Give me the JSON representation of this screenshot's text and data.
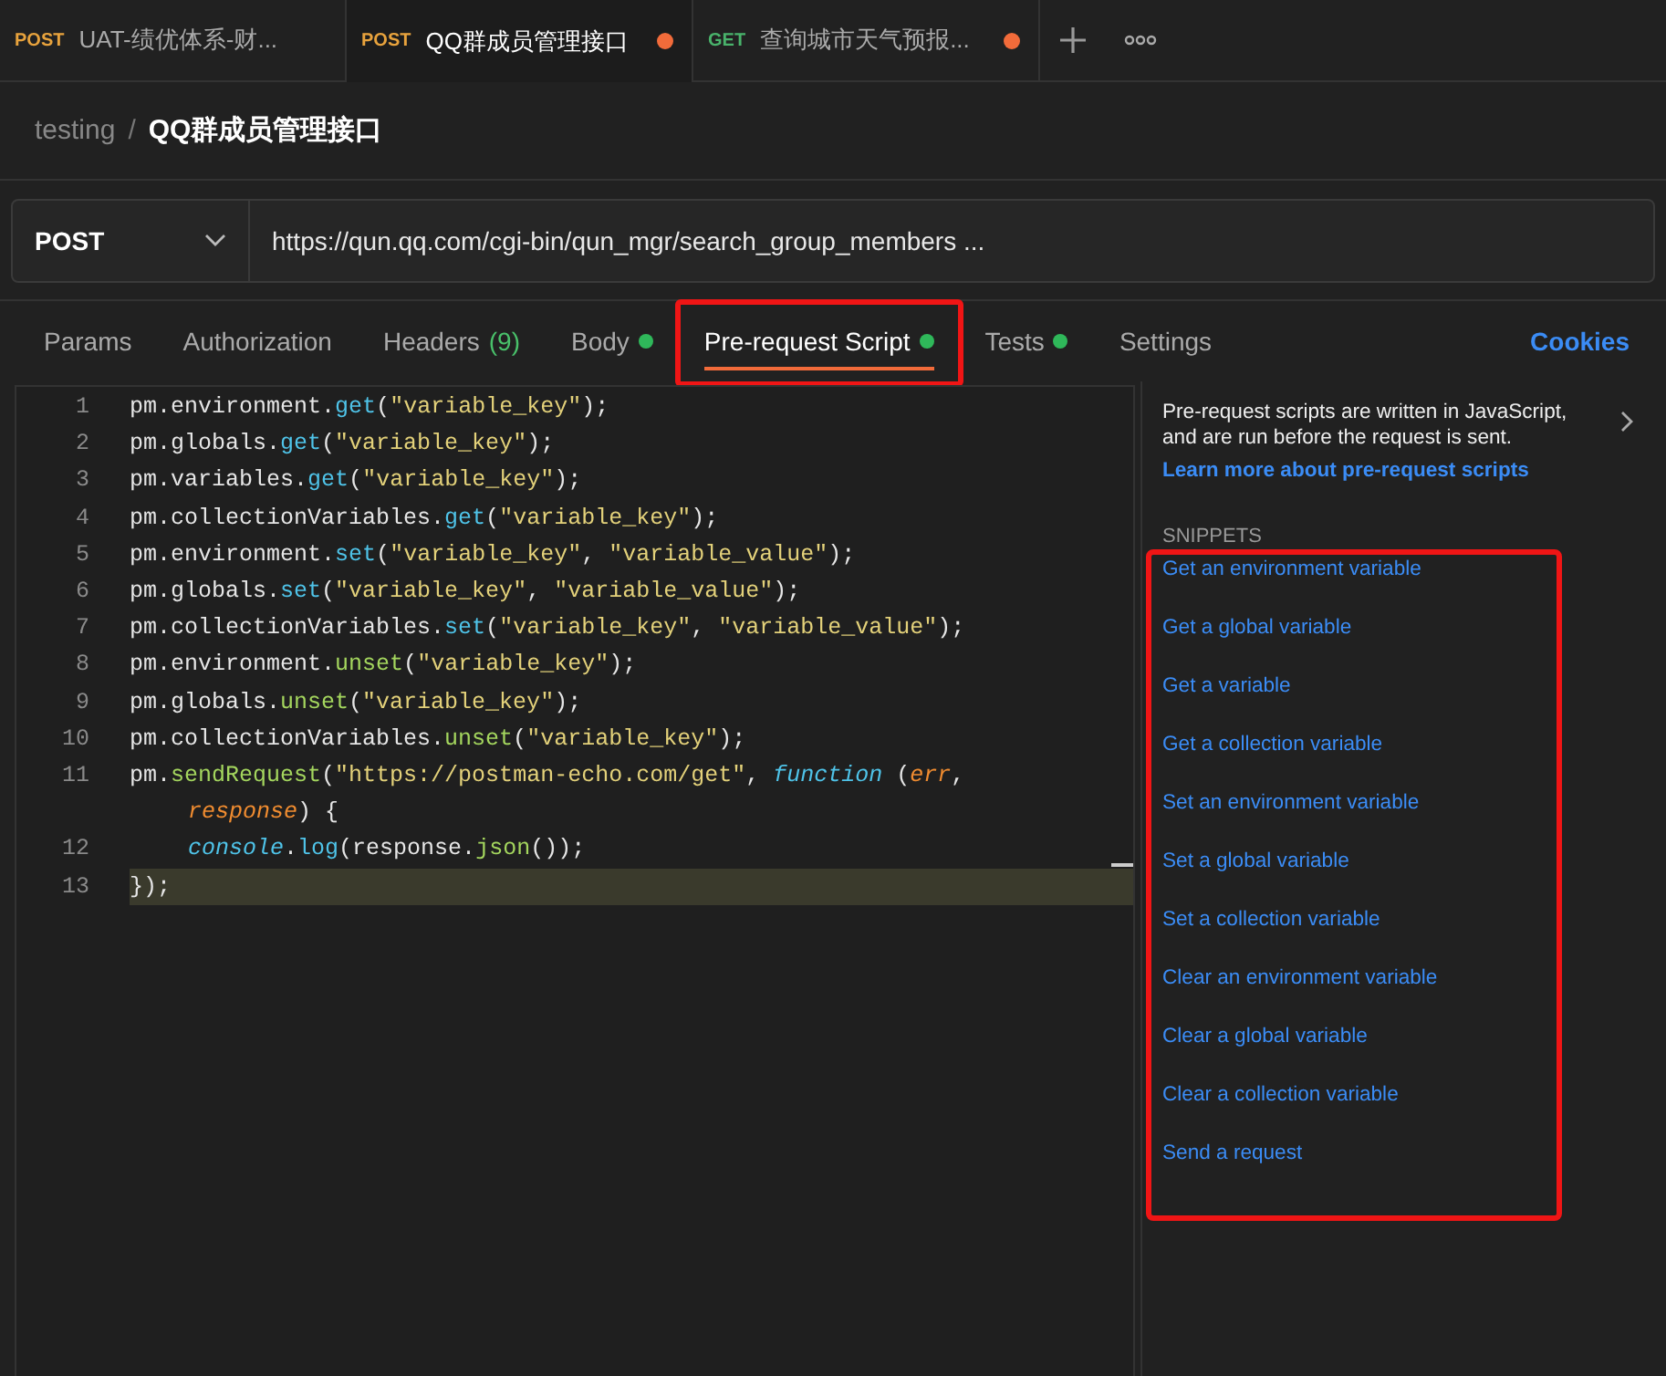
{
  "tabs": [
    {
      "method": "POST",
      "title": "UAT-绩优体系-财...",
      "selected": false,
      "unsaved": false
    },
    {
      "method": "POST",
      "title": "QQ群成员管理接口",
      "selected": true,
      "unsaved": true
    },
    {
      "method": "GET",
      "title": "查询城市天气预报...",
      "selected": false,
      "unsaved": true
    }
  ],
  "breadcrumb": {
    "collection": "testing",
    "separator": "/",
    "request": "QQ群成员管理接口"
  },
  "request": {
    "method": "POST",
    "url": "https://qun.qq.com/cgi-bin/qun_mgr/search_group_members ..."
  },
  "request_tabs": [
    {
      "label": "Params",
      "selected": false
    },
    {
      "label": "Authorization",
      "selected": false
    },
    {
      "label": "Headers",
      "count": "(9)",
      "selected": false
    },
    {
      "label": "Body",
      "dot": true,
      "selected": false
    },
    {
      "label": "Pre-request Script",
      "dot": true,
      "selected": true,
      "highlighted": true
    },
    {
      "label": "Tests",
      "dot": true,
      "selected": false
    },
    {
      "label": "Settings",
      "selected": false
    }
  ],
  "cookies_link": "Cookies",
  "editor": {
    "lines": [
      {
        "number": "1",
        "current": false,
        "tokens": [
          {
            "kind": "plain",
            "text": "pm.environment."
          },
          {
            "kind": "call",
            "text": "get"
          },
          {
            "kind": "plain",
            "text": "("
          },
          {
            "kind": "string",
            "text": "\"variable_key\""
          },
          {
            "kind": "plain",
            "text": ");"
          }
        ]
      },
      {
        "number": "2",
        "current": false,
        "tokens": [
          {
            "kind": "plain",
            "text": "pm.globals."
          },
          {
            "kind": "call",
            "text": "get"
          },
          {
            "kind": "plain",
            "text": "("
          },
          {
            "kind": "string",
            "text": "\"variable_key\""
          },
          {
            "kind": "plain",
            "text": ");"
          }
        ]
      },
      {
        "number": "3",
        "current": false,
        "tokens": [
          {
            "kind": "plain",
            "text": "pm.variables."
          },
          {
            "kind": "call",
            "text": "get"
          },
          {
            "kind": "plain",
            "text": "("
          },
          {
            "kind": "string",
            "text": "\"variable_key\""
          },
          {
            "kind": "plain",
            "text": ");"
          }
        ]
      },
      {
        "number": "4",
        "current": false,
        "tokens": [
          {
            "kind": "plain",
            "text": "pm.collectionVariables."
          },
          {
            "kind": "call",
            "text": "get"
          },
          {
            "kind": "plain",
            "text": "("
          },
          {
            "kind": "string",
            "text": "\"variable_key\""
          },
          {
            "kind": "plain",
            "text": ");"
          }
        ]
      },
      {
        "number": "5",
        "current": false,
        "tokens": [
          {
            "kind": "plain",
            "text": "pm.environment."
          },
          {
            "kind": "call",
            "text": "set"
          },
          {
            "kind": "plain",
            "text": "("
          },
          {
            "kind": "string",
            "text": "\"variable_key\""
          },
          {
            "kind": "plain",
            "text": ", "
          },
          {
            "kind": "string",
            "text": "\"variable_value\""
          },
          {
            "kind": "plain",
            "text": ");"
          }
        ]
      },
      {
        "number": "6",
        "current": false,
        "tokens": [
          {
            "kind": "plain",
            "text": "pm.globals."
          },
          {
            "kind": "call",
            "text": "set"
          },
          {
            "kind": "plain",
            "text": "("
          },
          {
            "kind": "string",
            "text": "\"variable_key\""
          },
          {
            "kind": "plain",
            "text": ", "
          },
          {
            "kind": "string",
            "text": "\"variable_value\""
          },
          {
            "kind": "plain",
            "text": ");"
          }
        ]
      },
      {
        "number": "7",
        "current": false,
        "tokens": [
          {
            "kind": "plain",
            "text": "pm.collectionVariables."
          },
          {
            "kind": "call",
            "text": "set"
          },
          {
            "kind": "plain",
            "text": "("
          },
          {
            "kind": "string",
            "text": "\"variable_key\""
          },
          {
            "kind": "plain",
            "text": ", "
          },
          {
            "kind": "string",
            "text": "\"variable_value\""
          },
          {
            "kind": "plain",
            "text": ");"
          }
        ]
      },
      {
        "number": "8",
        "current": false,
        "tokens": [
          {
            "kind": "plain",
            "text": "pm.environment."
          },
          {
            "kind": "fn",
            "text": "unset"
          },
          {
            "kind": "plain",
            "text": "("
          },
          {
            "kind": "string",
            "text": "\"variable_key\""
          },
          {
            "kind": "plain",
            "text": ");"
          }
        ]
      },
      {
        "number": "9",
        "current": false,
        "tokens": [
          {
            "kind": "plain",
            "text": "pm.globals."
          },
          {
            "kind": "fn",
            "text": "unset"
          },
          {
            "kind": "plain",
            "text": "("
          },
          {
            "kind": "string",
            "text": "\"variable_key\""
          },
          {
            "kind": "plain",
            "text": ");"
          }
        ]
      },
      {
        "number": "10",
        "current": false,
        "tokens": [
          {
            "kind": "plain",
            "text": "pm.collectionVariables."
          },
          {
            "kind": "fn",
            "text": "unset"
          },
          {
            "kind": "plain",
            "text": "("
          },
          {
            "kind": "string",
            "text": "\"variable_key\""
          },
          {
            "kind": "plain",
            "text": ");"
          }
        ]
      },
      {
        "number": "11",
        "current": false,
        "tokens": [
          {
            "kind": "plain",
            "text": "pm."
          },
          {
            "kind": "fn",
            "text": "sendRequest"
          },
          {
            "kind": "plain",
            "text": "("
          },
          {
            "kind": "string",
            "text": "\"https://postman-echo.com/get\""
          },
          {
            "kind": "plain",
            "text": ", "
          },
          {
            "kind": "keyword",
            "text": "function"
          },
          {
            "kind": "plain",
            "text": " ("
          },
          {
            "kind": "param",
            "text": "err"
          },
          {
            "kind": "plain",
            "text": ","
          }
        ],
        "continuation": [
          {
            "kind": "param",
            "text": "response"
          },
          {
            "kind": "plain",
            "text": ") {"
          }
        ]
      },
      {
        "number": "12",
        "current": false,
        "indented": true,
        "tokens": [
          {
            "kind": "builtin",
            "text": "console"
          },
          {
            "kind": "plain",
            "text": "."
          },
          {
            "kind": "call",
            "text": "log"
          },
          {
            "kind": "plain",
            "text": "(response."
          },
          {
            "kind": "fn",
            "text": "json"
          },
          {
            "kind": "plain",
            "text": "());"
          }
        ]
      },
      {
        "number": "13",
        "current": true,
        "tokens": [
          {
            "kind": "plain",
            "text": "});"
          }
        ]
      }
    ]
  },
  "info": {
    "text": "Pre-request scripts are written in JavaScript, and are run before the request is sent.",
    "link": "Learn more about pre-request scripts"
  },
  "snippets": {
    "heading": "SNIPPETS",
    "highlighted": true,
    "items": [
      "Get an environment variable",
      "Get a global variable",
      "Get a variable",
      "Get a collection variable",
      "Set an environment variable",
      "Set a global variable",
      "Set a collection variable",
      "Clear an environment variable",
      "Clear a global variable",
      "Clear a collection variable",
      "Send a request"
    ]
  }
}
